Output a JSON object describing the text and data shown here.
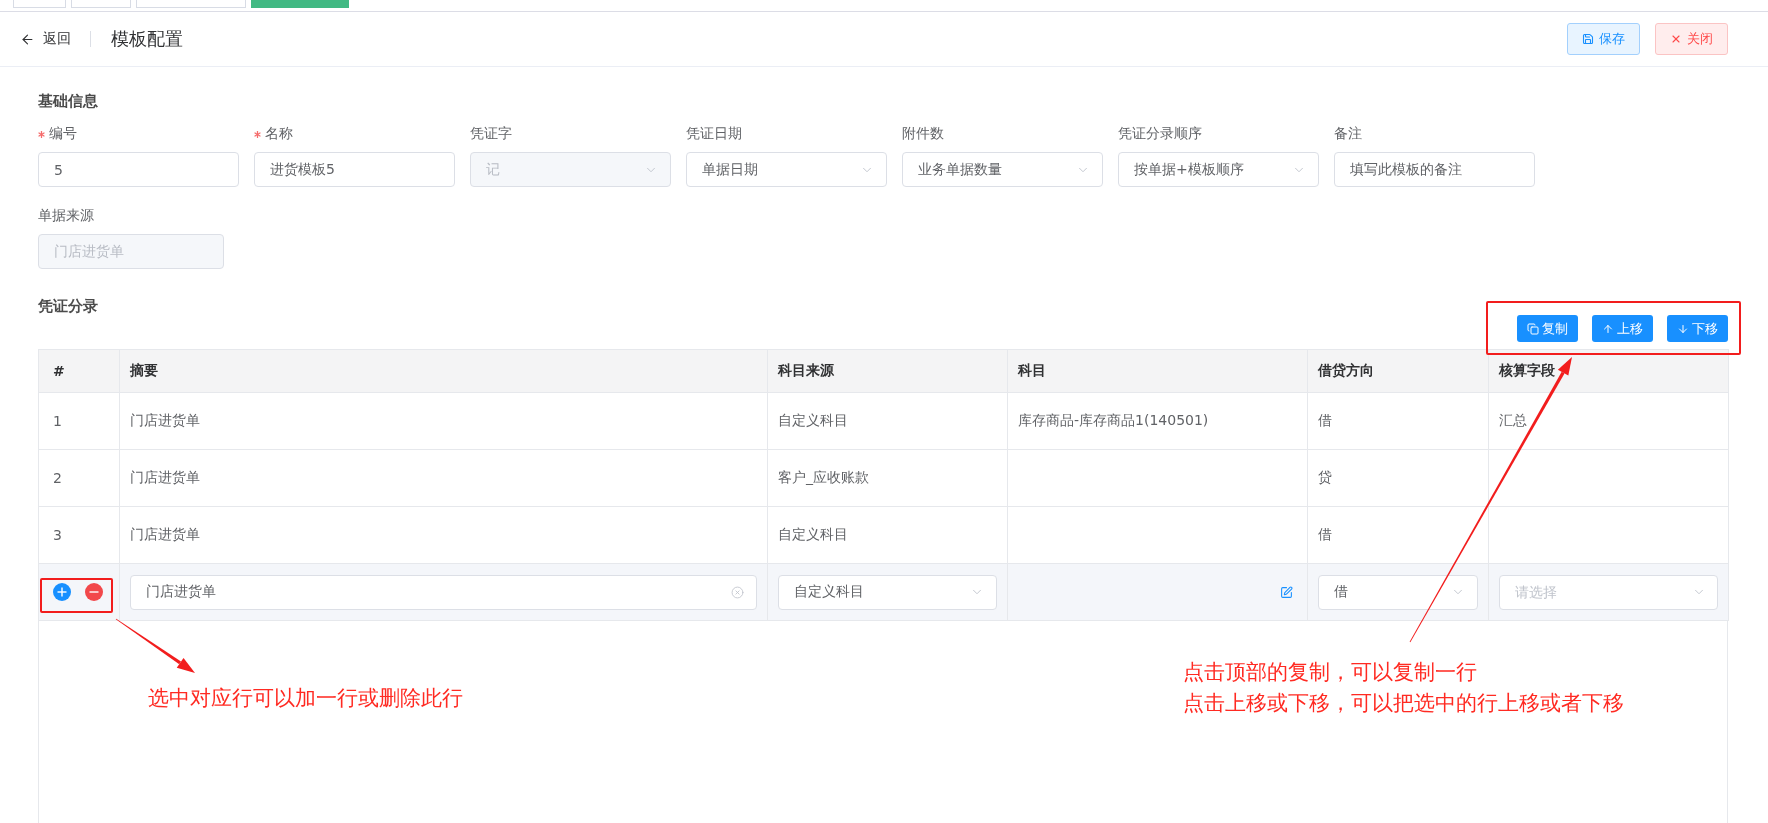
{
  "top_tabs": [
    {
      "selected": false
    },
    {
      "selected": false
    },
    {
      "selected": false
    },
    {
      "selected": true
    }
  ],
  "header": {
    "back_label": "返回",
    "title": "模板配置",
    "actions": [
      {
        "kind": "save",
        "label": "保存"
      },
      {
        "kind": "close",
        "label": "关闭"
      }
    ]
  },
  "basic_info": {
    "title": "基础信息",
    "rows": [
      {
        "fields": [
          {
            "label": "编号",
            "required": true,
            "kind": "input",
            "value": "5",
            "disabled": false
          },
          {
            "label": "名称",
            "required": true,
            "kind": "input",
            "value": "进货模板5",
            "disabled": false
          },
          {
            "label": "凭证字",
            "required": false,
            "kind": "select",
            "value": "记",
            "disabled": true
          },
          {
            "label": "凭证日期",
            "required": false,
            "kind": "select",
            "value": "单据日期",
            "disabled": false
          },
          {
            "label": "附件数",
            "required": false,
            "kind": "select",
            "value": "业务单据数量",
            "disabled": false
          },
          {
            "label": "凭证分录顺序",
            "required": false,
            "kind": "select",
            "value": "按单据+模板顺序",
            "disabled": false
          },
          {
            "label": "备注",
            "required": false,
            "kind": "input",
            "value": "填写此模板的备注",
            "disabled": false
          }
        ]
      },
      {
        "fields": [
          {
            "label": "单据来源",
            "required": false,
            "kind": "input",
            "value": "门店进货单",
            "disabled": true
          }
        ]
      }
    ]
  },
  "entries": {
    "title": "凭证分录",
    "actions": [
      {
        "kind": "copy",
        "label": "复制"
      },
      {
        "kind": "up",
        "label": "上移"
      },
      {
        "kind": "down",
        "label": "下移"
      }
    ],
    "columns": [
      "#",
      "摘要",
      "科目来源",
      "科目",
      "借贷方向",
      "核算字段"
    ],
    "rows": [
      {
        "selected": false,
        "no": "1",
        "summary": "门店进货单",
        "source": "自定义科目",
        "subject": "库存商品-库存商品1(140501)",
        "direction": "借",
        "field": "汇总"
      },
      {
        "selected": false,
        "no": "2",
        "summary": "门店进货单",
        "source": "客户_应收账款",
        "direction": "贷"
      },
      {
        "selected": false,
        "no": "3",
        "summary": "门店进货单",
        "source": "自定义科目",
        "direction": "借"
      },
      {
        "selected": true,
        "summary": "门店进货单",
        "source": "自定义科目",
        "direction": "借",
        "field": {
          "placeholder": "请选择"
        }
      }
    ]
  },
  "annotations": [
    {
      "kind": "row_tools",
      "lines": [
        "选中对应行可以加一行或删除此行"
      ]
    },
    {
      "kind": "toolbar",
      "lines": [
        "点击顶部的复制，可以复制一行",
        "点击上移或下移，可以把选中的行上移或者下移"
      ]
    }
  ]
}
